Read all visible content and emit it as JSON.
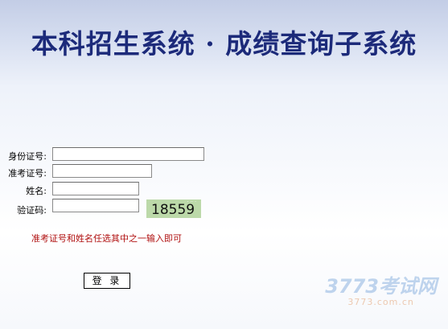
{
  "header": {
    "title": "本科招生系统 · 成绩查询子系统"
  },
  "form": {
    "id_label": "身份证号:",
    "exam_label": "准考证号:",
    "name_label": "姓名:",
    "captcha_label": "验证码:",
    "captcha_value": "18559",
    "hint": "准考证号和姓名任选其中之一输入即可",
    "login_label": "登 录"
  },
  "watermark": {
    "main": "3773考试网",
    "sub": "3773.com.cn"
  }
}
